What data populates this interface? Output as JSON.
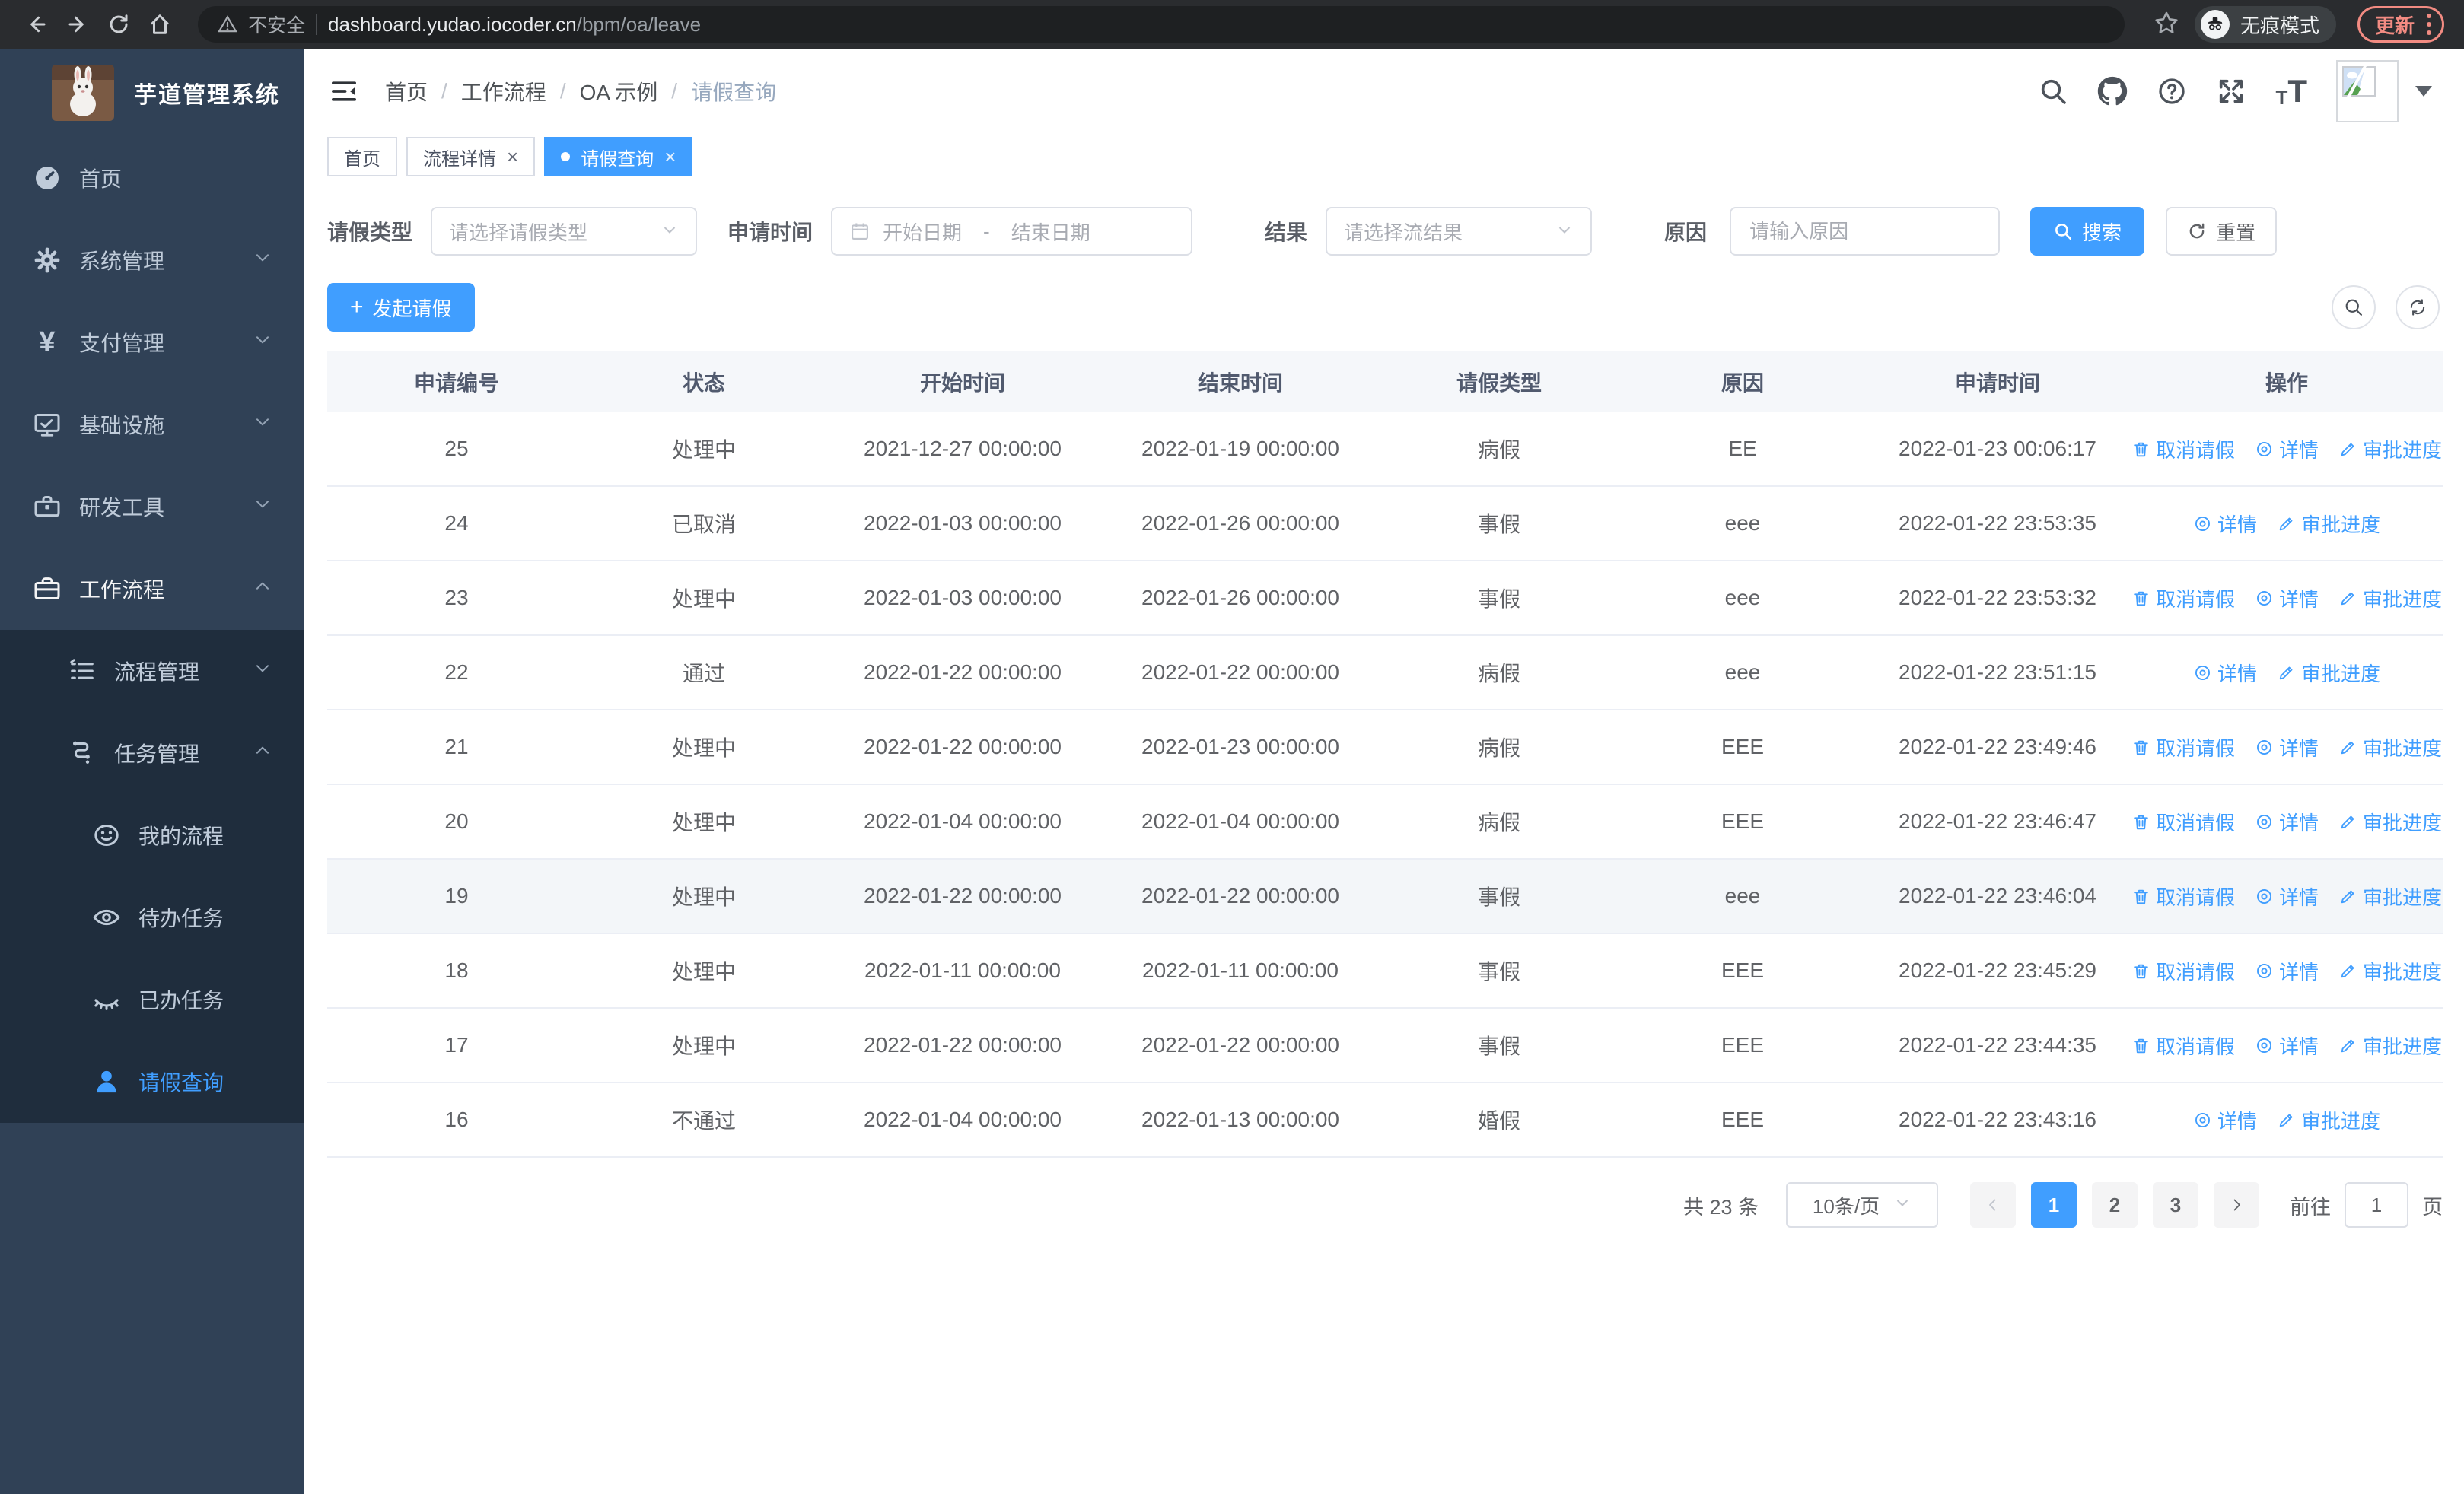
{
  "colors": {
    "primary": "#409eff",
    "sidebar_bg": "#304156",
    "submenu_bg": "#1f2d3d",
    "update_accent": "#f28b82",
    "link": "#409eff"
  },
  "browser": {
    "security_label": "不安全",
    "url_main": "dashboard.yudao.iocoder.cn",
    "url_path": "/bpm/oa/leave",
    "incognito_label": "无痕模式",
    "update_label": "更新"
  },
  "sidebar": {
    "title": "芋道管理系统",
    "items": [
      {
        "icon": "dashboard-icon",
        "label": "首页",
        "level": 1
      },
      {
        "icon": "gear-icon",
        "label": "系统管理",
        "level": 1,
        "chevron": "down"
      },
      {
        "icon": "yen-icon",
        "label": "支付管理",
        "level": 1,
        "chevron": "down"
      },
      {
        "icon": "monitor-icon",
        "label": "基础设施",
        "level": 1,
        "chevron": "down"
      },
      {
        "icon": "toolbox-icon",
        "label": "研发工具",
        "level": 1,
        "chevron": "down"
      },
      {
        "icon": "briefcase-icon",
        "label": "工作流程",
        "level": 1,
        "chevron": "up",
        "parent_open": true
      },
      {
        "icon": "list-icon",
        "label": "流程管理",
        "level": 2,
        "chevron": "down",
        "dark": true
      },
      {
        "icon": "tree-icon",
        "label": "任务管理",
        "level": 2,
        "chevron": "up",
        "dark": true
      },
      {
        "icon": "face-icon",
        "label": "我的流程",
        "level": 3,
        "dark": true
      },
      {
        "icon": "eye-open-icon",
        "label": "待办任务",
        "level": 3,
        "dark": true
      },
      {
        "icon": "eye-closed-icon",
        "label": "已办任务",
        "level": 3,
        "dark": true
      },
      {
        "icon": "user-icon",
        "label": "请假查询",
        "level": 3,
        "dark": true,
        "active": true
      }
    ]
  },
  "header": {
    "breadcrumb": [
      "首页",
      "工作流程",
      "OA 示例",
      "请假查询"
    ]
  },
  "tabs": [
    {
      "label": "首页",
      "closable": false,
      "active": false
    },
    {
      "label": "流程详情",
      "closable": true,
      "active": false
    },
    {
      "label": "请假查询",
      "closable": true,
      "active": true
    }
  ],
  "filters": {
    "leave_type": {
      "label": "请假类型",
      "placeholder": "请选择请假类型"
    },
    "apply_time": {
      "label": "申请时间",
      "start_placeholder": "开始日期",
      "separator": "-",
      "end_placeholder": "结束日期"
    },
    "result": {
      "label": "结果",
      "placeholder": "请选择流结果"
    },
    "reason": {
      "label": "原因",
      "placeholder": "请输入原因"
    },
    "search_label": "搜索",
    "reset_label": "重置"
  },
  "toolbar": {
    "create_label": "发起请假"
  },
  "table": {
    "columns": [
      "申请编号",
      "状态",
      "开始时间",
      "结束时间",
      "请假类型",
      "原因",
      "申请时间",
      "操作"
    ],
    "action_labels": {
      "cancel": "取消请假",
      "detail": "详情",
      "progress": "审批进度"
    },
    "rows": [
      {
        "id": "25",
        "status": "处理中",
        "start": "2021-12-27 00:00:00",
        "end": "2022-01-19 00:00:00",
        "type": "病假",
        "reason": "EE",
        "apply": "2022-01-23 00:06:17",
        "can_cancel": true,
        "hover": false
      },
      {
        "id": "24",
        "status": "已取消",
        "start": "2022-01-03 00:00:00",
        "end": "2022-01-26 00:00:00",
        "type": "事假",
        "reason": "eee",
        "apply": "2022-01-22 23:53:35",
        "can_cancel": false,
        "hover": false
      },
      {
        "id": "23",
        "status": "处理中",
        "start": "2022-01-03 00:00:00",
        "end": "2022-01-26 00:00:00",
        "type": "事假",
        "reason": "eee",
        "apply": "2022-01-22 23:53:32",
        "can_cancel": true,
        "hover": false
      },
      {
        "id": "22",
        "status": "通过",
        "start": "2022-01-22 00:00:00",
        "end": "2022-01-22 00:00:00",
        "type": "病假",
        "reason": "eee",
        "apply": "2022-01-22 23:51:15",
        "can_cancel": false,
        "hover": false
      },
      {
        "id": "21",
        "status": "处理中",
        "start": "2022-01-22 00:00:00",
        "end": "2022-01-23 00:00:00",
        "type": "病假",
        "reason": "EEE",
        "apply": "2022-01-22 23:49:46",
        "can_cancel": true,
        "hover": false
      },
      {
        "id": "20",
        "status": "处理中",
        "start": "2022-01-04 00:00:00",
        "end": "2022-01-04 00:00:00",
        "type": "病假",
        "reason": "EEE",
        "apply": "2022-01-22 23:46:47",
        "can_cancel": true,
        "hover": false
      },
      {
        "id": "19",
        "status": "处理中",
        "start": "2022-01-22 00:00:00",
        "end": "2022-01-22 00:00:00",
        "type": "事假",
        "reason": "eee",
        "apply": "2022-01-22 23:46:04",
        "can_cancel": true,
        "hover": true
      },
      {
        "id": "18",
        "status": "处理中",
        "start": "2022-01-11 00:00:00",
        "end": "2022-01-11 00:00:00",
        "type": "事假",
        "reason": "EEE",
        "apply": "2022-01-22 23:45:29",
        "can_cancel": true,
        "hover": false
      },
      {
        "id": "17",
        "status": "处理中",
        "start": "2022-01-22 00:00:00",
        "end": "2022-01-22 00:00:00",
        "type": "事假",
        "reason": "EEE",
        "apply": "2022-01-22 23:44:35",
        "can_cancel": true,
        "hover": false
      },
      {
        "id": "16",
        "status": "不通过",
        "start": "2022-01-04 00:00:00",
        "end": "2022-01-13 00:00:00",
        "type": "婚假",
        "reason": "EEE",
        "apply": "2022-01-22 23:43:16",
        "can_cancel": false,
        "hover": false
      }
    ]
  },
  "pagination": {
    "total_text": "共 23 条",
    "page_size": "10条/页",
    "pages": [
      "1",
      "2",
      "3"
    ],
    "active_page": "1",
    "goto_label": "前往",
    "goto_value": "1",
    "page_label": "页"
  }
}
